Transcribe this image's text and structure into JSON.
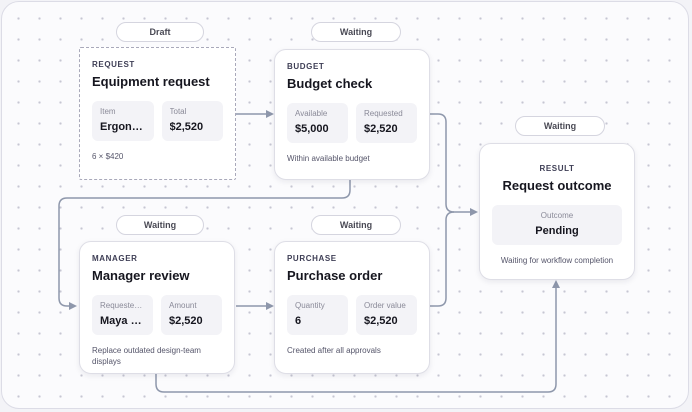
{
  "nodes": {
    "request": {
      "status": "Draft",
      "kicker": "REQUEST",
      "title": "Equipment request",
      "fields": [
        {
          "label": "Item",
          "value": "Ergono…"
        },
        {
          "label": "Total",
          "value": "$2,520"
        }
      ],
      "note": "6 × $420"
    },
    "budget": {
      "status": "Waiting",
      "kicker": "BUDGET",
      "title": "Budget check",
      "fields": [
        {
          "label": "Available",
          "value": "$5,000"
        },
        {
          "label": "Requested",
          "value": "$2,520"
        }
      ],
      "note": "Within available budget"
    },
    "manager": {
      "status": "Waiting",
      "kicker": "MANAGER",
      "title": "Manager review",
      "fields": [
        {
          "label": "Requested …",
          "value": "Maya C…"
        },
        {
          "label": "Amount",
          "value": "$2,520"
        }
      ],
      "note": "Replace outdated design-team displays"
    },
    "purchase": {
      "status": "Waiting",
      "kicker": "PURCHASE",
      "title": "Purchase order",
      "fields": [
        {
          "label": "Quantity",
          "value": "6"
        },
        {
          "label": "Order value",
          "value": "$2,520"
        }
      ],
      "note": "Created after all approvals"
    },
    "result": {
      "status": "Waiting",
      "kicker": "RESULT",
      "title": "Request outcome",
      "field": {
        "label": "Outcome",
        "value": "Pending"
      },
      "note": "Waiting for workflow completion"
    }
  },
  "colors": {
    "edge": "#8e97ab",
    "canvas": "#fbfbfd",
    "card_border": "#dedee6"
  }
}
